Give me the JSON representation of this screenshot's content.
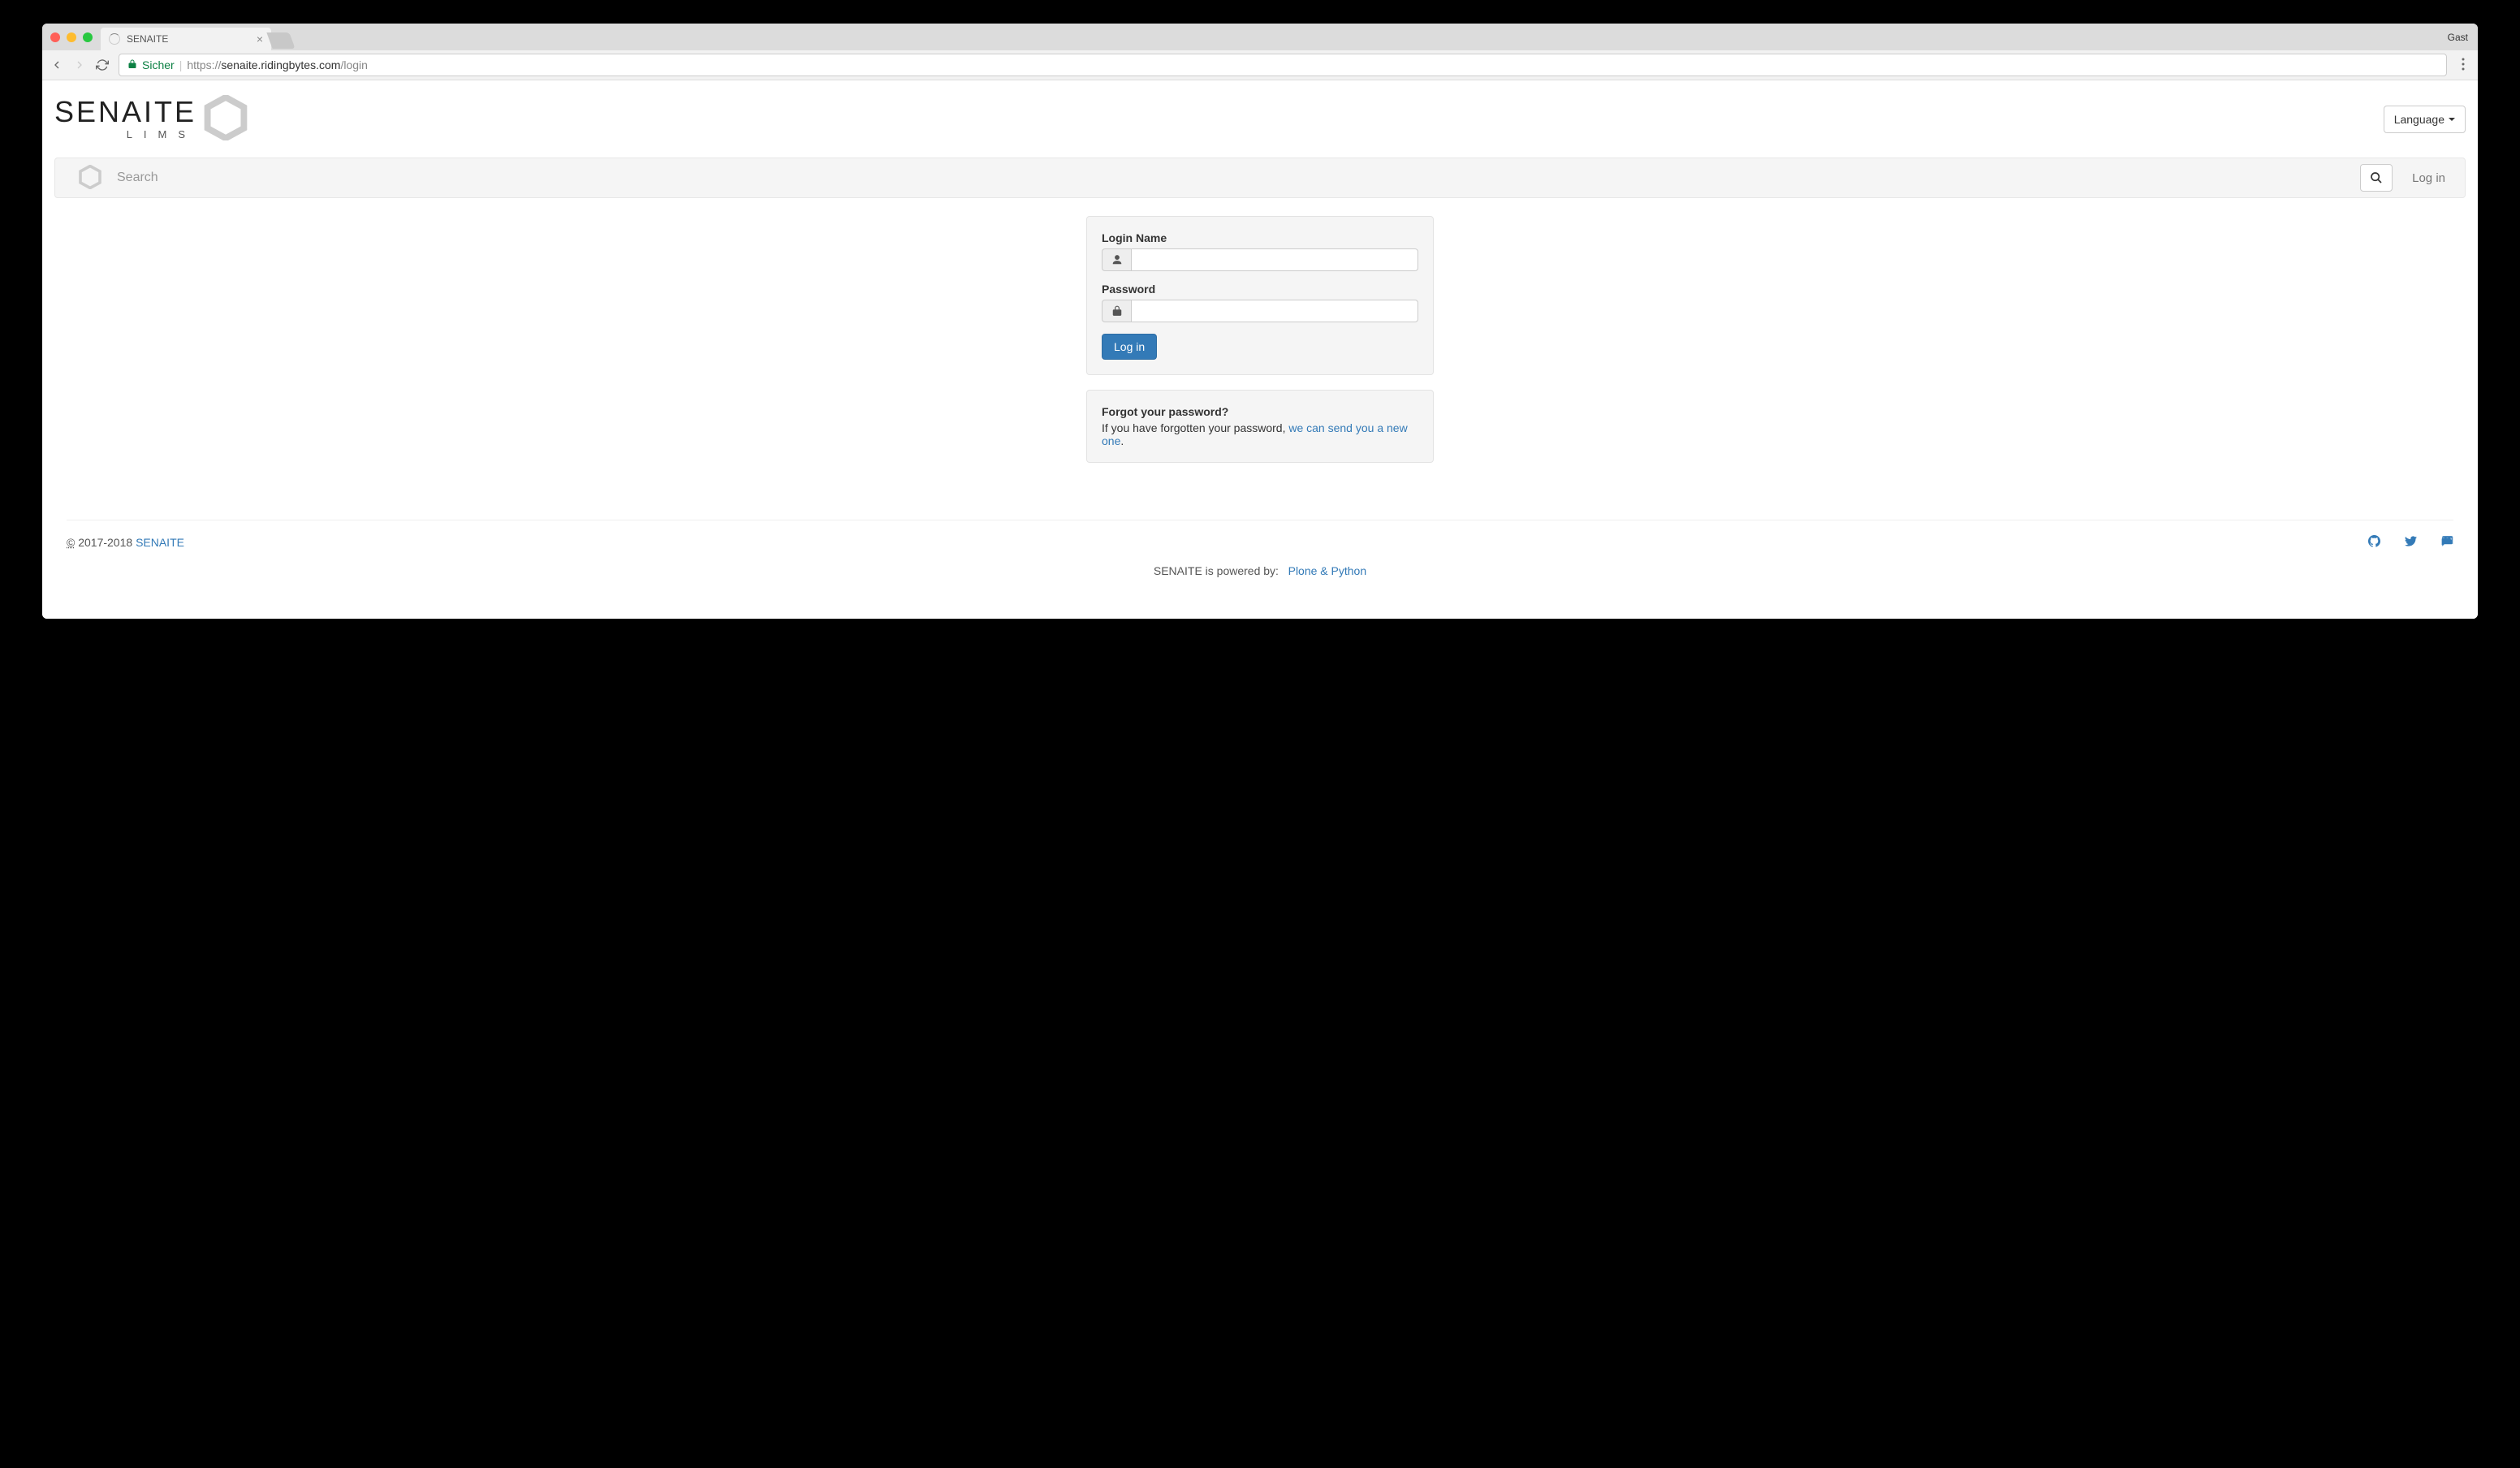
{
  "browser": {
    "tab_title": "SENAITE",
    "guest_label": "Gast",
    "secure_label": "Sicher",
    "url_protocol": "https://",
    "url_domain": "senaite.ridingbytes.com",
    "url_path": "/login"
  },
  "header": {
    "logo_main": "SENAITE",
    "logo_sub": "LIMS",
    "language_label": "Language"
  },
  "searchbar": {
    "placeholder": "Search",
    "login_link": "Log in"
  },
  "login_form": {
    "login_name_label": "Login Name",
    "password_label": "Password",
    "submit_label": "Log in"
  },
  "forgot": {
    "heading": "Forgot your password?",
    "text": "If you have forgotten your password, ",
    "link": "we can send you a new one",
    "period": "."
  },
  "footer": {
    "copyright_symbol": "©",
    "copyright_years": " 2017-2018 ",
    "copyright_link": "SENAITE",
    "powered_text": "SENAITE is powered by:",
    "powered_link": "Plone & Python"
  }
}
